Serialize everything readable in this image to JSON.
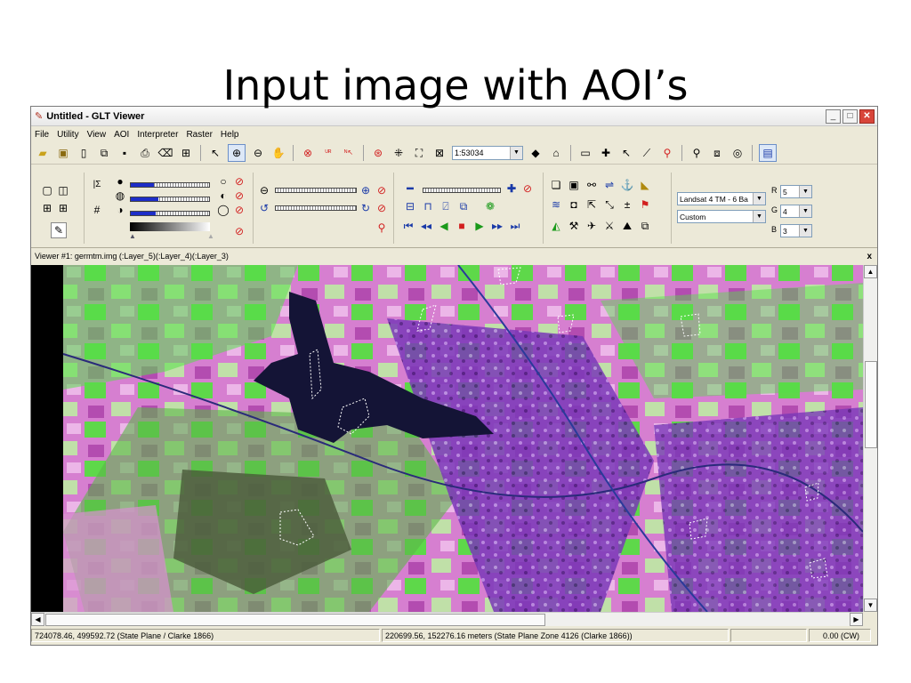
{
  "slide": {
    "title": "Input image with AOI’s"
  },
  "window": {
    "title": "Untitled - GLT Viewer",
    "min": "_",
    "max": "□",
    "close": "✕"
  },
  "menu": [
    "File",
    "Utility",
    "View",
    "AOI",
    "Interpreter",
    "Raster",
    "Help"
  ],
  "toolbar": {
    "scale_value": "1:53034"
  },
  "bands": {
    "profile_value": "Landsat 4 TM - 6 Ba",
    "stretch_value": "Custom",
    "r_label": "R",
    "r_value": "5",
    "g_label": "G",
    "g_value": "4",
    "b_label": "B",
    "b_value": "3"
  },
  "adjust": {
    "brightness_level": 0.3,
    "contrast_level": 0.35,
    "gamma_level": 0.32
  },
  "viewer": {
    "caption": "Viewer #1: germtm.img (:Layer_5)(:Layer_4)(:Layer_3)",
    "close": "x"
  },
  "status": {
    "map_coords": "724078.46, 499592.72  (State Plane / Clarke 1866)",
    "geo_coords": "220699.56, 152276.16 meters (State Plane Zone 4126 (Clarke 1866))",
    "rotation": "0.00 (CW)"
  },
  "colors": {
    "water": "#141436",
    "vegetation": "#55e048",
    "urban": "#7a38b8",
    "fields": "#d67fd0"
  }
}
